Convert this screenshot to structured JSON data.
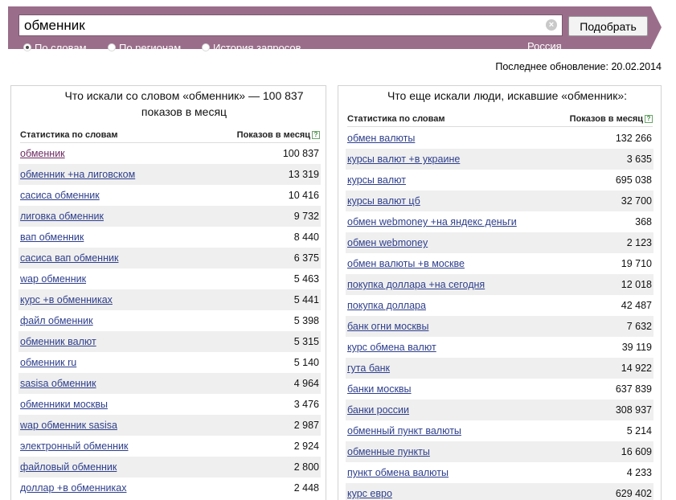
{
  "search": {
    "value": "обменник",
    "submit_label": "Подобрать"
  },
  "tabs": [
    {
      "label": "По словам",
      "selected": true
    },
    {
      "label": "По регионам",
      "selected": false
    },
    {
      "label": "История запросов",
      "selected": false
    }
  ],
  "region": "Россия",
  "last_update": "Последнее обновление: 20.02.2014",
  "left": {
    "title": "Что искали со словом «обменник» — 100 837 показов в месяц",
    "col_left": "Статистика по словам",
    "col_right": "Показов в месяц",
    "rows": [
      {
        "q": "обменник",
        "n": "100 837"
      },
      {
        "q": "обменник +на лиговском",
        "n": "13 319"
      },
      {
        "q": "сасиса обменник",
        "n": "10 416"
      },
      {
        "q": "лиговка обменник",
        "n": "9 732"
      },
      {
        "q": "вап обменник",
        "n": "8 440"
      },
      {
        "q": "сасиса вап обменник",
        "n": "6 375"
      },
      {
        "q": "wap обменник",
        "n": "5 463"
      },
      {
        "q": "курс +в обменниках",
        "n": "5 441"
      },
      {
        "q": "файл обменник",
        "n": "5 398"
      },
      {
        "q": "обменник валют",
        "n": "5 315"
      },
      {
        "q": "обменник ru",
        "n": "5 140"
      },
      {
        "q": "sasisa обменник",
        "n": "4 964"
      },
      {
        "q": "обменники москвы",
        "n": "3 476"
      },
      {
        "q": "wap обменник sasisa",
        "n": "2 987"
      },
      {
        "q": "электронный обменник",
        "n": "2 924"
      },
      {
        "q": "файловый обменник",
        "n": "2 800"
      },
      {
        "q": "доллар +в обменниках",
        "n": "2 448"
      }
    ]
  },
  "right": {
    "title": "Что еще искали люди, искавшие «обменник»:",
    "col_left": "Статистика по словам",
    "col_right": "Показов в месяц",
    "rows": [
      {
        "q": "обмен валюты",
        "n": "132 266"
      },
      {
        "q": "курсы валют +в украине",
        "n": "3 635"
      },
      {
        "q": "курсы валют",
        "n": "695 038"
      },
      {
        "q": "курсы валют цб",
        "n": "32 700"
      },
      {
        "q": "обмен webmoney +на яндекс деньги",
        "n": "368"
      },
      {
        "q": "обмен webmoney",
        "n": "2 123"
      },
      {
        "q": "обмен валюты +в москве",
        "n": "19 710"
      },
      {
        "q": "покупка доллара +на сегодня",
        "n": "12 018"
      },
      {
        "q": "покупка доллара",
        "n": "42 487"
      },
      {
        "q": "банк огни москвы",
        "n": "7 632"
      },
      {
        "q": "курс обмена валют",
        "n": "39 119"
      },
      {
        "q": "гута банк",
        "n": "14 922"
      },
      {
        "q": "банки москвы",
        "n": "637 839"
      },
      {
        "q": "банки россии",
        "n": "308 937"
      },
      {
        "q": "обменный пункт валюты",
        "n": "5 214"
      },
      {
        "q": "обменные пункты",
        "n": "16 609"
      },
      {
        "q": "пункт обмена валюты",
        "n": "4 233"
      },
      {
        "q": "курс евро",
        "n": "629 402"
      }
    ]
  }
}
